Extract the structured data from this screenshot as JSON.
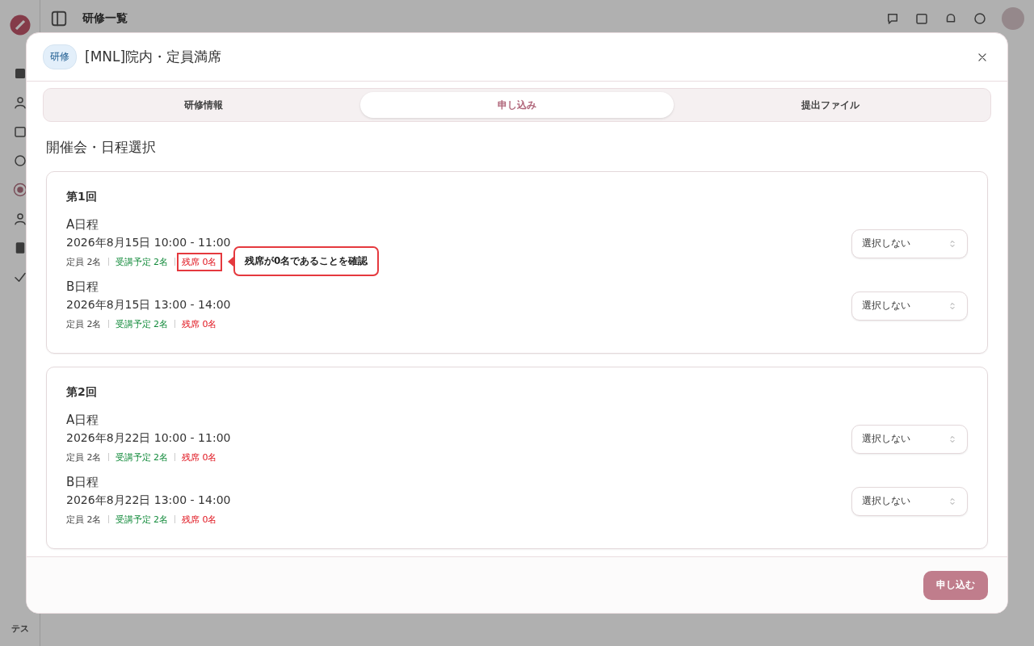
{
  "app": {
    "page_title": "研修一覧",
    "user_initials": "テス"
  },
  "dialog": {
    "tag": "研修",
    "title": "[MNL]院内・定員満席"
  },
  "tabs": [
    {
      "label": "研修情報",
      "selected": false
    },
    {
      "label": "申し込み",
      "selected": true
    },
    {
      "label": "提出ファイル",
      "selected": false
    }
  ],
  "section_title": "開催会・日程選択",
  "sessions": [
    {
      "title": "第1回",
      "schedules": [
        {
          "name": "A日程",
          "datetime": "2026年8月15日 10:00 - 11:00",
          "capacity": "定員 2名",
          "enrolled": "受講予定 2名",
          "remaining": "残席 0名",
          "highlighted": true,
          "annotation": "残席が0名であることを確認",
          "select": "選択しない"
        },
        {
          "name": "B日程",
          "datetime": "2026年8月15日 13:00 - 14:00",
          "capacity": "定員 2名",
          "enrolled": "受講予定 2名",
          "remaining": "残席 0名",
          "highlighted": false,
          "select": "選択しない"
        }
      ]
    },
    {
      "title": "第2回",
      "schedules": [
        {
          "name": "A日程",
          "datetime": "2026年8月22日 10:00 - 11:00",
          "capacity": "定員 2名",
          "enrolled": "受講予定 2名",
          "remaining": "残席 0名",
          "highlighted": false,
          "select": "選択しない"
        },
        {
          "name": "B日程",
          "datetime": "2026年8月22日 13:00 - 14:00",
          "capacity": "定員 2名",
          "enrolled": "受講予定 2名",
          "remaining": "残席 0名",
          "highlighted": false,
          "select": "選択しない"
        }
      ]
    }
  ],
  "submit_button": "申し込む"
}
